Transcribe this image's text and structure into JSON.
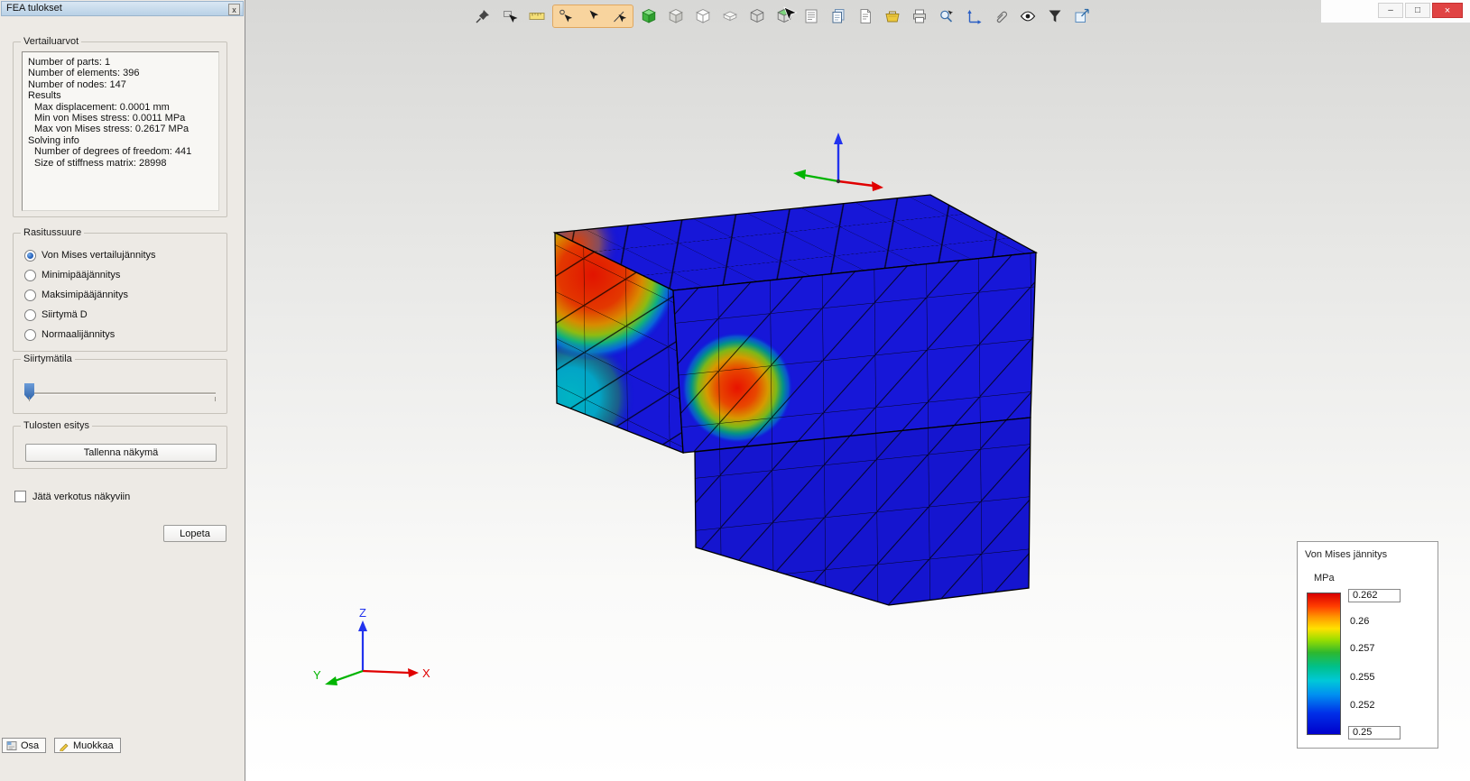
{
  "panel": {
    "title": "FEA tulokset",
    "close": "x",
    "stats": {
      "label": "Vertailuarvot",
      "lines": [
        "Number of parts: 1",
        "Number of elements: 396",
        "Number of nodes: 147",
        "Results",
        "Max displacement: 0.0001 mm",
        "Min von Mises stress: 0.0011 MPa",
        "Max von Mises stress: 0.2617 MPa",
        "Solving info",
        "Number of degrees of freedom: 441",
        "Size of stiffness matrix: 28998"
      ]
    },
    "stress_group": {
      "label": "Rasitussuure",
      "options": [
        {
          "label": "Von Mises vertailujännitys",
          "selected": true
        },
        {
          "label": "Minimipääjännitys",
          "selected": false
        },
        {
          "label": "Maksimipääjännitys",
          "selected": false
        },
        {
          "label": "Siirtymä D",
          "selected": false
        },
        {
          "label": "Normaalijännitys",
          "selected": false
        }
      ]
    },
    "displacement_group": {
      "label": "Siirtymätila"
    },
    "results_group": {
      "label": "Tulosten esitys",
      "save_view_button": "Tallenna näkymä"
    },
    "mesh_checkbox_label": "Jätä verkotus näkyviin",
    "quit_button": "Lopeta"
  },
  "tabs": [
    {
      "label": "Osa"
    },
    {
      "label": "Muokkaa"
    }
  ],
  "toolbar": {
    "icons": [
      "pin",
      "select-box",
      "ruler",
      "snap-circle",
      "select-cursor",
      "snap-angle",
      "solid-cube",
      "shaded-box",
      "framed-box",
      "thin-box",
      "wire-cube",
      "face-select-cube",
      "list",
      "copy-layers",
      "document",
      "material-bin",
      "printer",
      "zoom-select",
      "axes",
      "attach",
      "visibility-eye",
      "filter",
      "export-window"
    ]
  },
  "window_controls": {
    "minimize": "–",
    "maximize": "□",
    "close": "×"
  },
  "viewport": {
    "triad_labels": {
      "x": "X",
      "y": "Y",
      "z": "Z"
    }
  },
  "legend": {
    "title": "Von Mises jännitys",
    "unit": "MPa",
    "values": [
      "0.262",
      "0.26",
      "0.257",
      "0.255",
      "0.252",
      "0.25"
    ]
  },
  "colors": {
    "model_blue": "#1717d8",
    "stress_max": "#d80000",
    "stress_min": "#0000cc",
    "tool_highlight": "#f8d49e",
    "close_button": "#e04343",
    "axis_x": "#e00000",
    "axis_y": "#00b400",
    "axis_z": "#2233ee"
  }
}
